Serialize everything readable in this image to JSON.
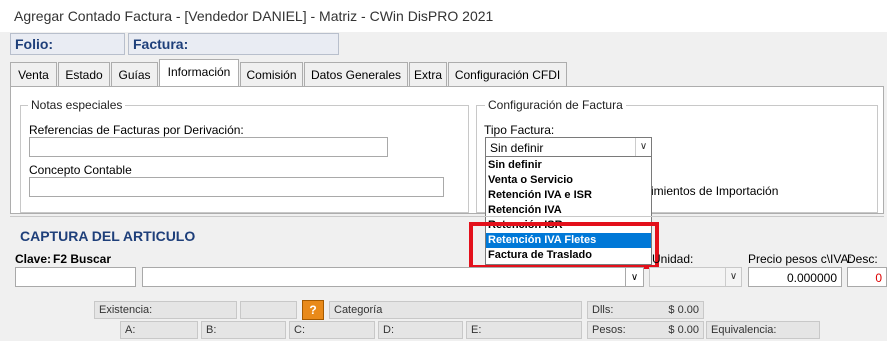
{
  "window": {
    "title": "Agregar Contado Factura - [Vendedor DANIEL] - Matriz - CWin DisPRO 2021"
  },
  "header": {
    "folio_label": "Folio:",
    "factura_label": "Factura:"
  },
  "tabs": [
    {
      "label": "Venta"
    },
    {
      "label": "Estado"
    },
    {
      "label": "Guías"
    },
    {
      "label": "Información"
    },
    {
      "label": "Comisión"
    },
    {
      "label": "Datos Generales"
    },
    {
      "label": "Extra"
    },
    {
      "label": "Configuración CFDI"
    }
  ],
  "notas": {
    "legend": "Notas especiales",
    "ref_label": "Referencias de Facturas por Derivación:",
    "ref_value": "",
    "concepto_label": "Concepto Contable",
    "concepto_value": ""
  },
  "config": {
    "legend": "Configuración de Factura",
    "tipo_label": "Tipo Factura:",
    "tipo_value": "Sin definir",
    "options": [
      "Sin definir",
      "Venta o Servicio",
      "Retención IVA e ISR",
      "Retención IVA",
      "Retención ISR",
      "Retención IVA Fletes",
      "Factura de Traslado"
    ],
    "selected_option": "Retención IVA Fletes",
    "hidden_text": "imientos de Importación"
  },
  "captura": {
    "title": "CAPTURA DEL ARTICULO",
    "clave_label": "Clave:",
    "buscar_label": "F2 Buscar",
    "unidad_label": "Unidad:",
    "precio_label": "Precio pesos c\\IVA:",
    "desc_label": "Desc:",
    "precio_value": "0.000000",
    "desc_value": "0",
    "add_symbol": "+"
  },
  "info": {
    "existencia": "Existencia:",
    "help": "?",
    "categoria": "Categoría",
    "dlls_label": "Dlls:",
    "dlls_value": "$ 0.00",
    "a": "A:",
    "b": "B:",
    "c": "C:",
    "d": "D:",
    "e": "E:",
    "pesos_label": "Pesos:",
    "pesos_value": "$ 0.00",
    "equivalencia": "Equivalencia:"
  },
  "colors": {
    "accent": "#1e3f7a",
    "highlight": "#0078d7",
    "red_box": "#e3101b"
  }
}
